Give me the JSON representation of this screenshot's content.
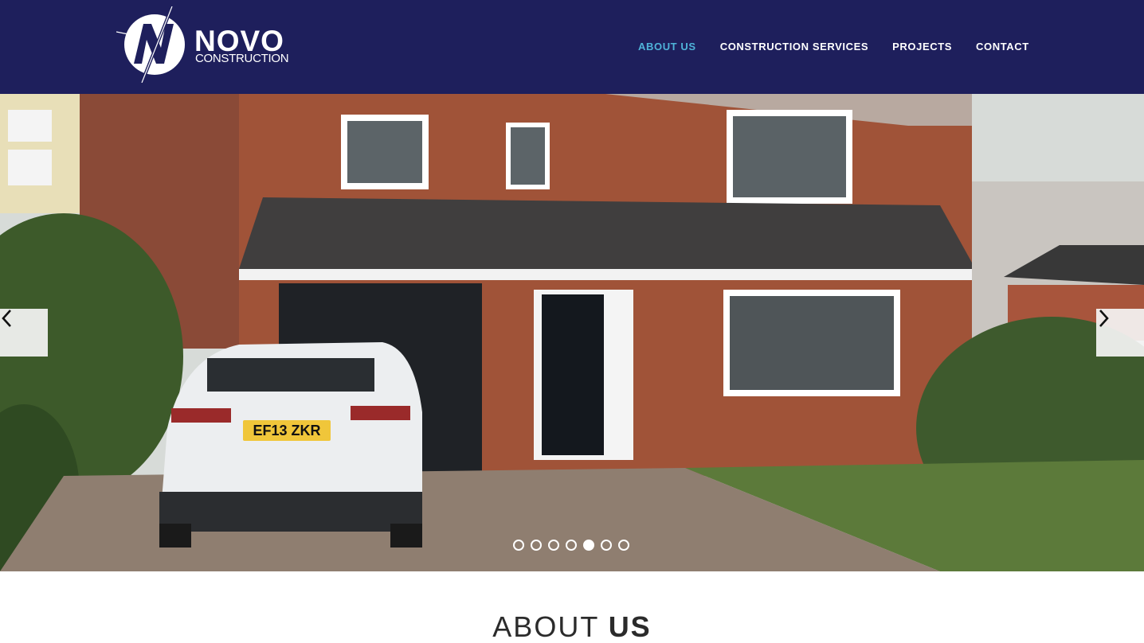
{
  "header": {
    "logo": {
      "word": "NOVO",
      "sub": "CONSTRUCTION"
    },
    "nav": [
      {
        "label": "ABOUT US",
        "active": true
      },
      {
        "label": "CONSTRUCTION SERVICES",
        "active": false
      },
      {
        "label": "PROJECTS",
        "active": false
      },
      {
        "label": "CONTACT",
        "active": false
      }
    ]
  },
  "hero": {
    "plate": "EF13 ZKR",
    "slides_total": 7,
    "active_slide": 5,
    "prev_icon": "chevron-left-icon",
    "next_icon": "chevron-right-icon"
  },
  "about": {
    "title_light": "ABOUT",
    "title_bold": "US"
  },
  "colors": {
    "header_bg": "#1e1f5c",
    "nav_active": "#4fb3d9",
    "nav_text": "#ffffff"
  }
}
